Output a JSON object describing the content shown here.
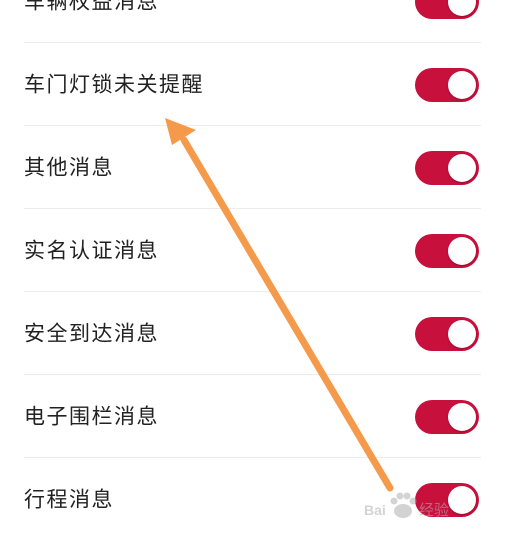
{
  "settings": {
    "items": [
      {
        "label": "车辆权益消息",
        "enabled": true
      },
      {
        "label": "车门灯锁未关提醒",
        "enabled": true
      },
      {
        "label": "其他消息",
        "enabled": true
      },
      {
        "label": "实名认证消息",
        "enabled": true
      },
      {
        "label": "安全到达消息",
        "enabled": true
      },
      {
        "label": "电子围栏消息",
        "enabled": true
      },
      {
        "label": "行程消息",
        "enabled": true
      }
    ]
  },
  "colors": {
    "switch_on": "#c8103d",
    "annotation_arrow": "#f59a4a",
    "divider": "#ececec"
  },
  "annotation": {
    "icon": "arrow-pointing-up-left"
  },
  "watermark": {
    "text": "Baidu 经验",
    "icon": "baidu-paw-icon"
  }
}
